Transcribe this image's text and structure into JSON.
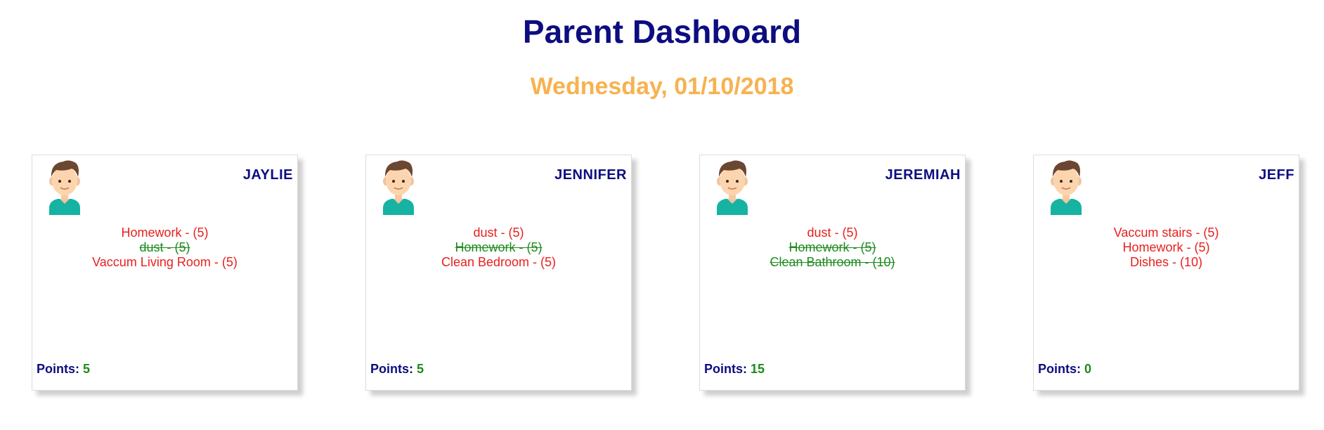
{
  "header": {
    "title": "Parent Dashboard",
    "date": "Wednesday, 01/10/2018"
  },
  "colors": {
    "title": "#0d0d80",
    "date": "#f7b24f",
    "pending_chore": "#e8201e",
    "completed_chore": "#1d8a1d",
    "points_value": "#1d8a1d"
  },
  "points_label": "Points:",
  "children": [
    {
      "name": "JAYLIE",
      "avatar_icon": "boy-avatar-icon",
      "chores": [
        {
          "label": "Homework - (5)",
          "done": false
        },
        {
          "label": "dust - (5)",
          "done": true
        },
        {
          "label": "Vaccum Living Room - (5)",
          "done": false
        }
      ],
      "points": "5"
    },
    {
      "name": "JENNIFER",
      "avatar_icon": "boy-avatar-icon",
      "chores": [
        {
          "label": "dust - (5)",
          "done": false
        },
        {
          "label": "Homework - (5)",
          "done": true
        },
        {
          "label": "Clean Bedroom - (5)",
          "done": false
        }
      ],
      "points": "5"
    },
    {
      "name": "JEREMIAH",
      "avatar_icon": "boy-avatar-icon",
      "chores": [
        {
          "label": "dust - (5)",
          "done": false
        },
        {
          "label": "Homework - (5)",
          "done": true
        },
        {
          "label": "Clean Bathroom - (10)",
          "done": true
        }
      ],
      "points": "15"
    },
    {
      "name": "JEFF",
      "avatar_icon": "boy-avatar-icon",
      "chores": [
        {
          "label": "Vaccum stairs - (5)",
          "done": false
        },
        {
          "label": "Homework - (5)",
          "done": false
        },
        {
          "label": "Dishes - (10)",
          "done": false
        }
      ],
      "points": "0"
    }
  ]
}
